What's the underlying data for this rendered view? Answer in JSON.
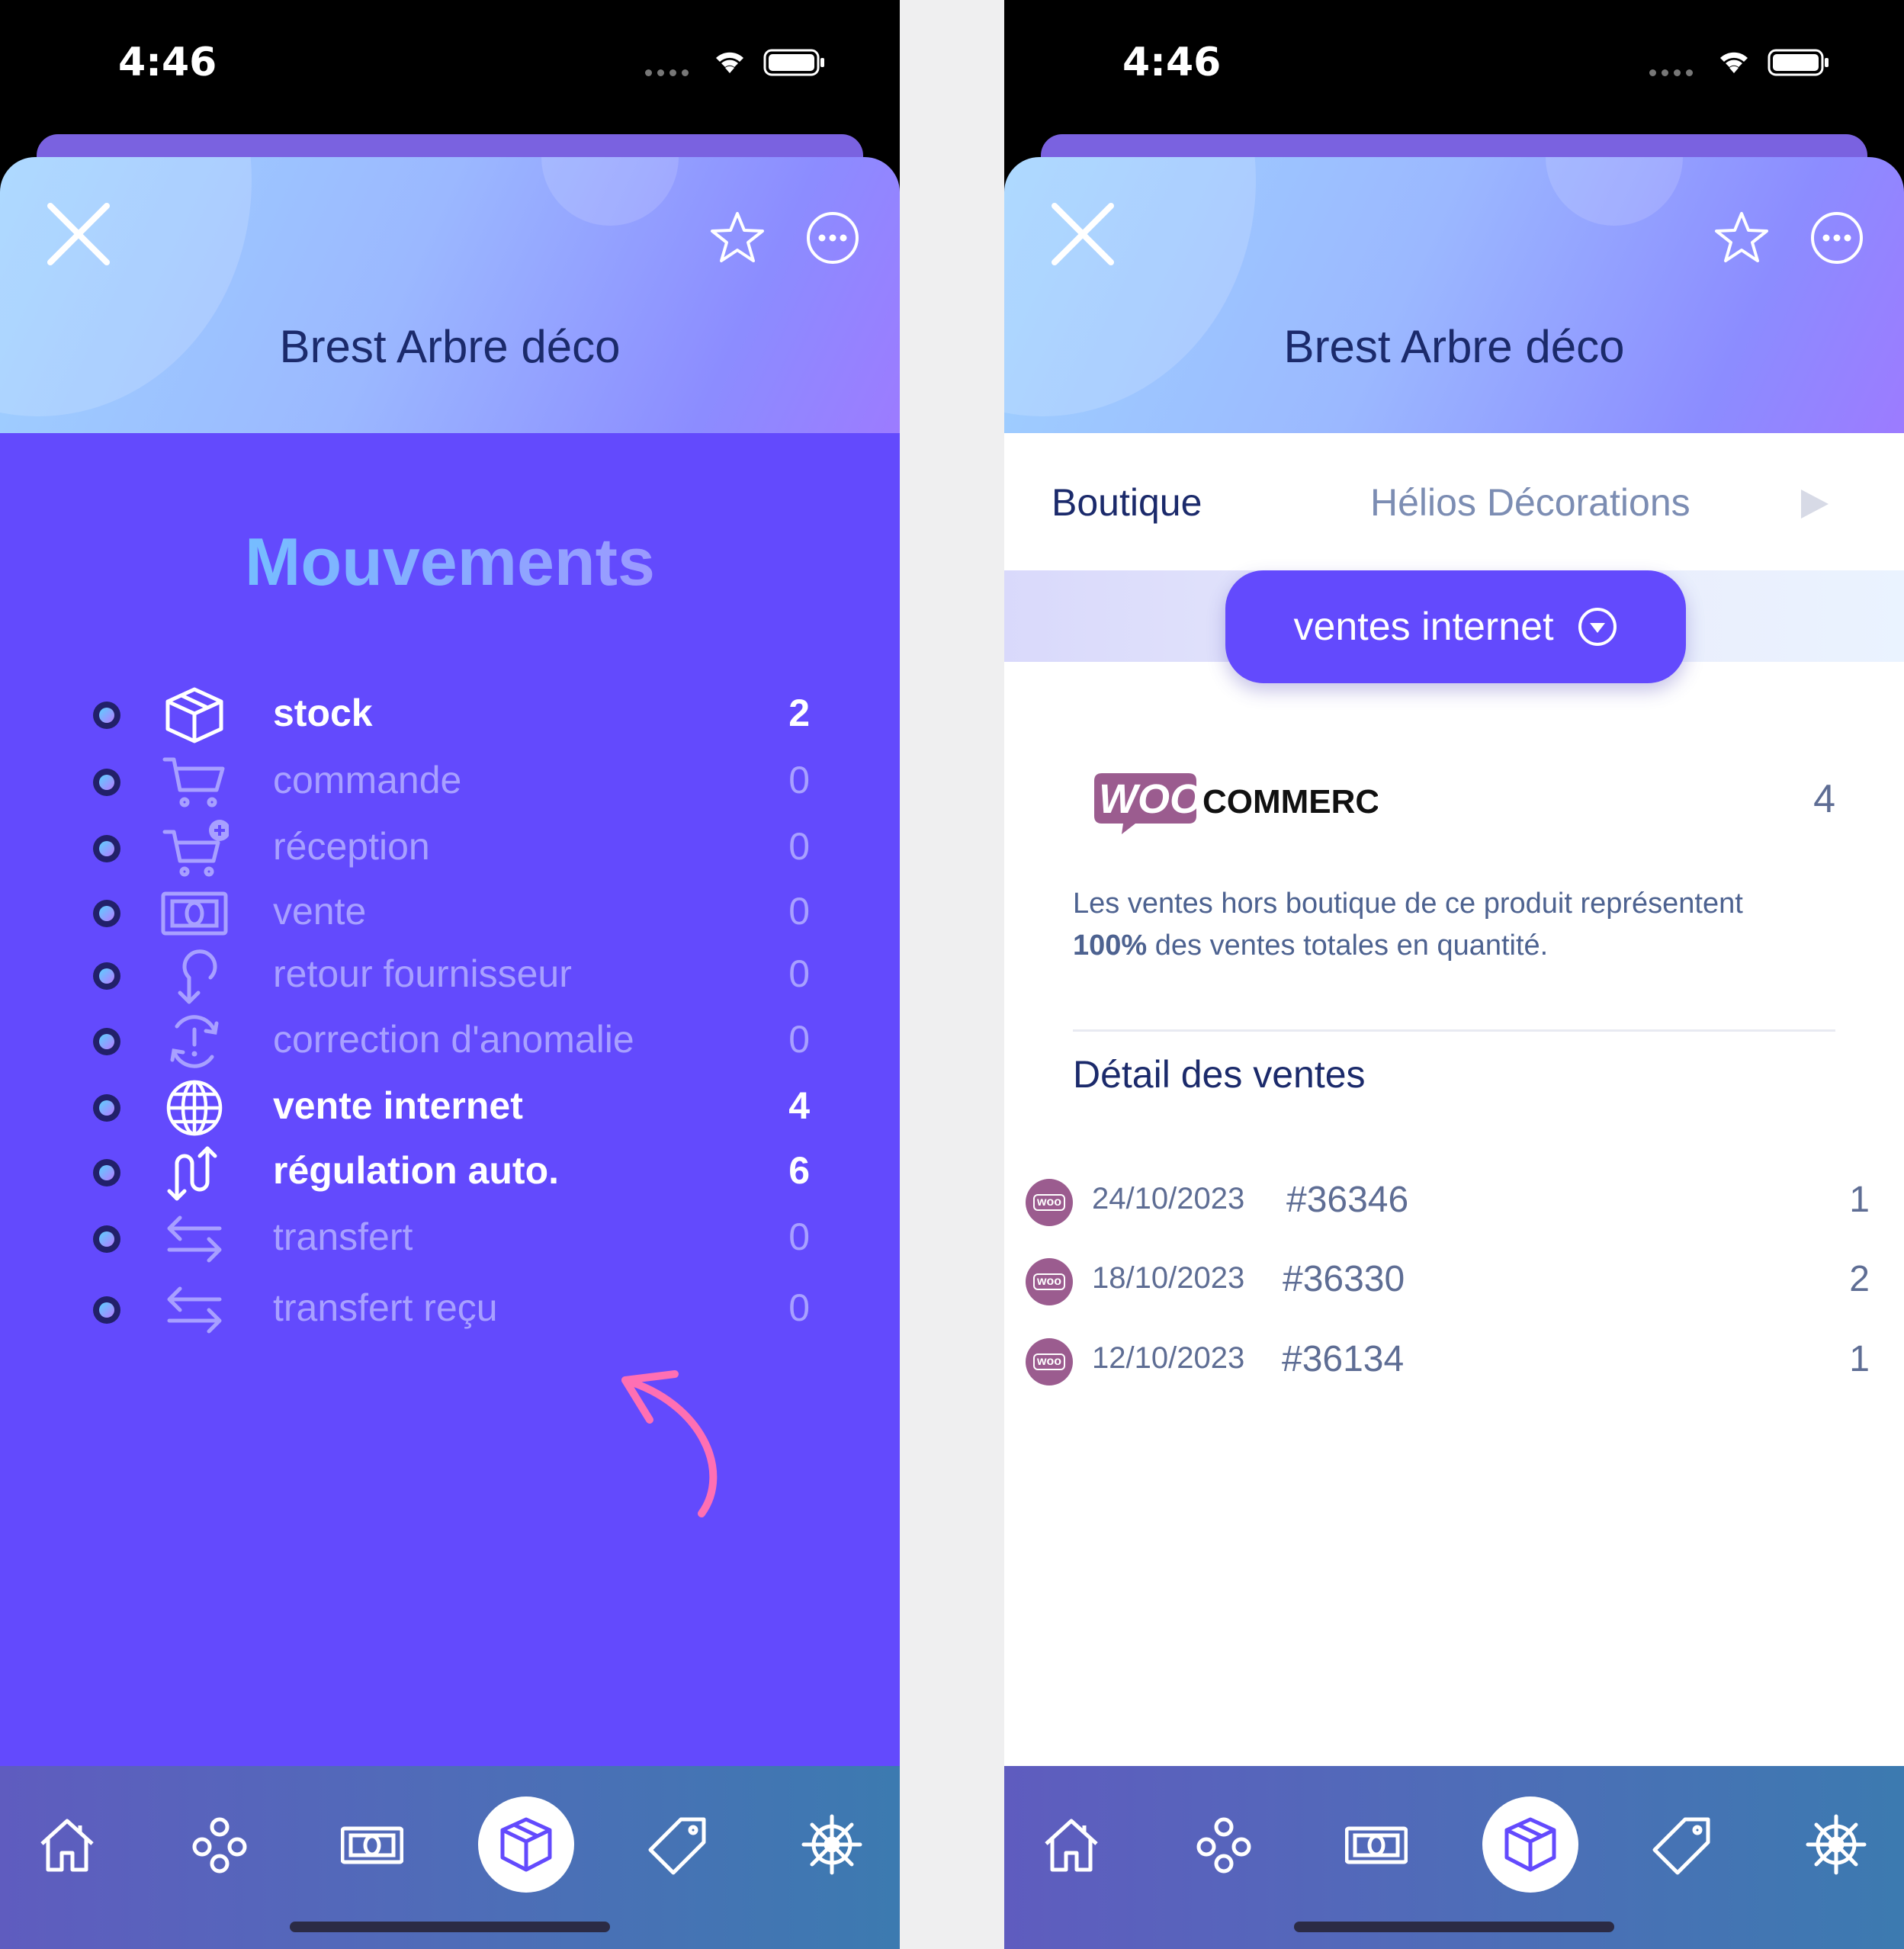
{
  "status": {
    "time": "4:46"
  },
  "header": {
    "title": "Brest Arbre déco"
  },
  "left": {
    "section_title": "Mouvements",
    "rows": [
      {
        "label": "stock",
        "count": "2",
        "icon": "box-icon",
        "active": true
      },
      {
        "label": "commande",
        "count": "0",
        "icon": "cart-icon",
        "active": false
      },
      {
        "label": "réception",
        "count": "0",
        "icon": "cart-plus-icon",
        "active": false
      },
      {
        "label": "vente",
        "count": "0",
        "icon": "banknote-icon",
        "active": false
      },
      {
        "label": "retour fournisseur",
        "count": "0",
        "icon": "return-arrow-icon",
        "active": false
      },
      {
        "label": "correction d'anomalie",
        "count": "0",
        "icon": "refresh-alert-icon",
        "active": false
      },
      {
        "label": "vente internet",
        "count": "4",
        "icon": "globe-icon",
        "active": true
      },
      {
        "label": "régulation auto.",
        "count": "6",
        "icon": "regulation-arrows-icon",
        "active": true
      },
      {
        "label": "transfert",
        "count": "0",
        "icon": "transfer-icon",
        "active": false
      },
      {
        "label": "transfert reçu",
        "count": "0",
        "icon": "transfer-received-icon",
        "active": false
      }
    ]
  },
  "right": {
    "tabs": {
      "active": "Boutique",
      "inactive": "Hélios Décorations"
    },
    "dropdown_label": "ventes internet",
    "woocommerce": {
      "logo_text": "WOOCOMMERCE",
      "count": "4",
      "description_part1": "Les ventes hors boutique de ce produit représentent",
      "description_percent": "100%",
      "description_part2": " des ventes totales en quantité."
    },
    "detail_title": "Détail des ventes",
    "sales": [
      {
        "date": "24/10/2023",
        "ref": "#36346",
        "qty": "1"
      },
      {
        "date": "18/10/2023",
        "ref": "#36330",
        "qty": "2"
      },
      {
        "date": "12/10/2023",
        "ref": "#36134",
        "qty": "1"
      }
    ]
  },
  "nav": {
    "items": [
      "home-icon",
      "modules-icon",
      "banknote-icon",
      "box-icon",
      "tag-icon",
      "helm-icon"
    ],
    "active_index": 3
  },
  "colors": {
    "primary": "#634afd",
    "title_dark": "#1b2a6b",
    "woo_purple": "#9b5c8f",
    "arrow_pink": "#ff6fb3"
  }
}
